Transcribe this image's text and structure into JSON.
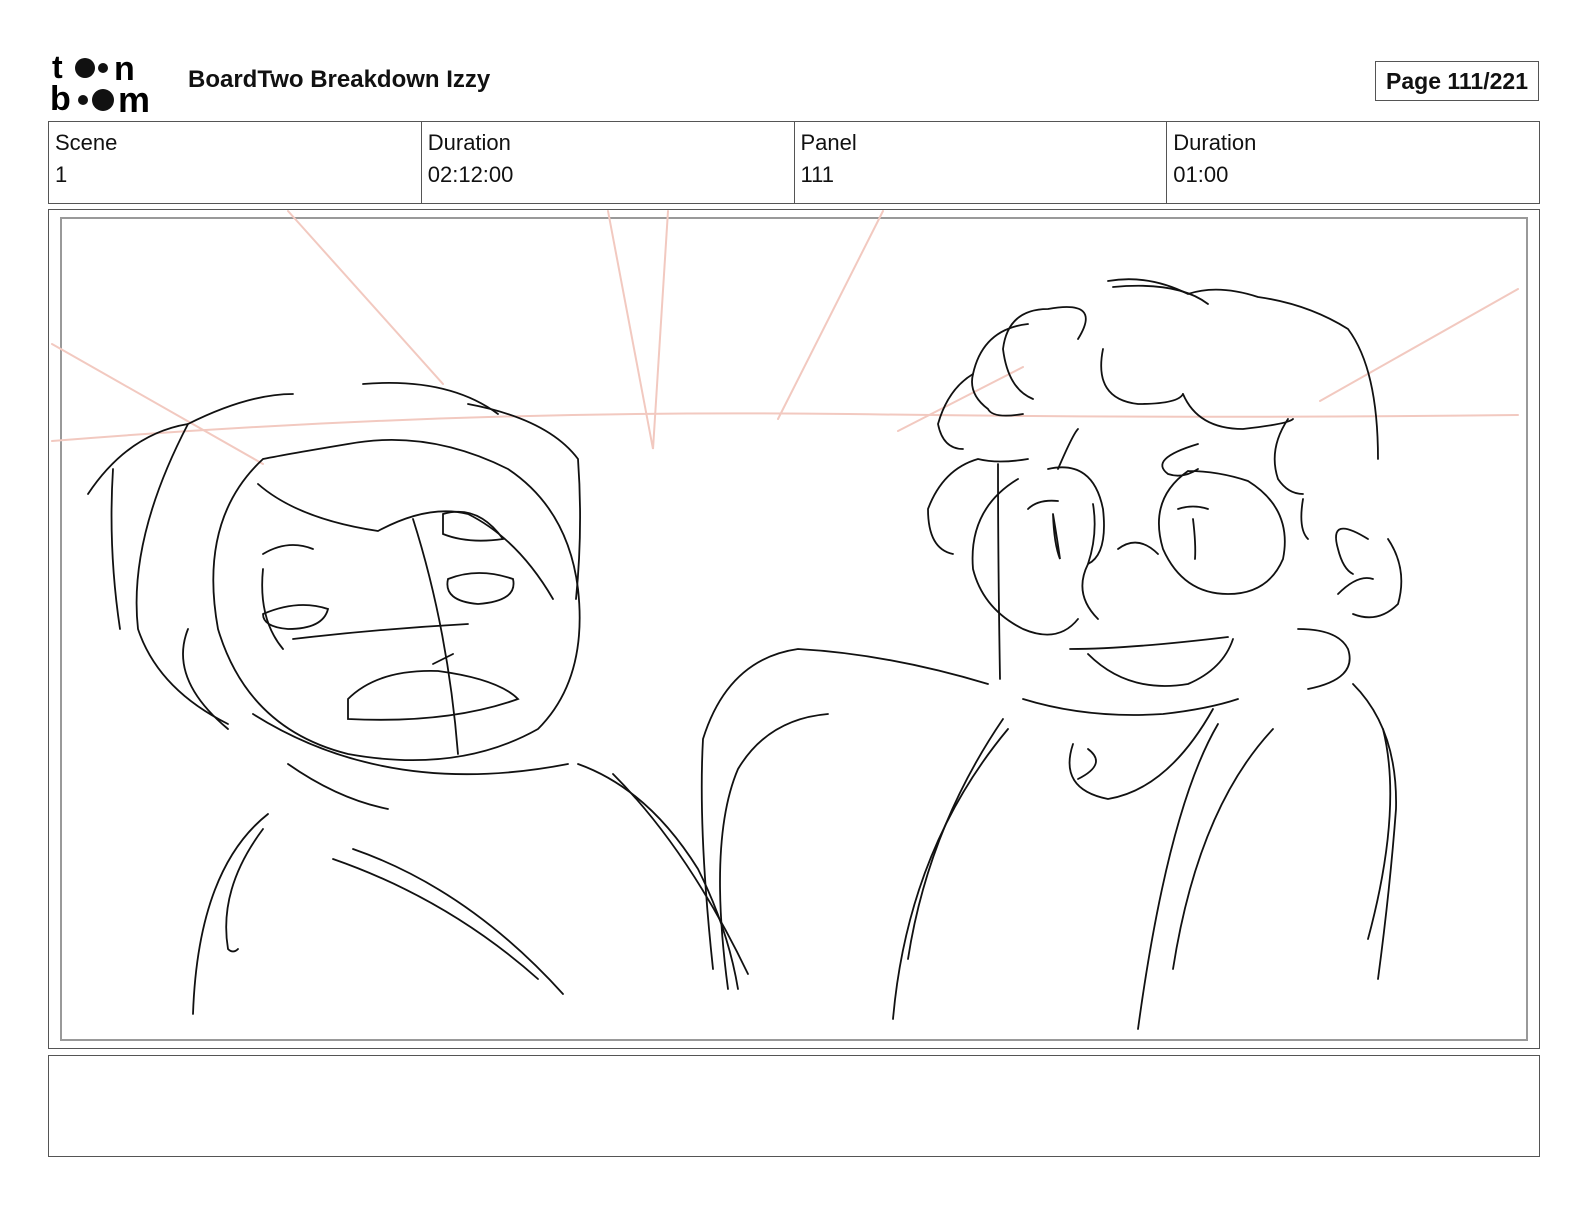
{
  "header": {
    "logo_alt": "toon boom",
    "title": "BoardTwo Breakdown Izzy",
    "page_label": "Page 111/221"
  },
  "info": {
    "scene_label": "Scene",
    "scene_value": "1",
    "scene_duration_label": "Duration",
    "scene_duration_value": "02:12:00",
    "panel_label": "Panel",
    "panel_value": "111",
    "panel_duration_label": "Duration",
    "panel_duration_value": "01:00"
  },
  "panel": {
    "image": "storyboard-sketch",
    "guide_color": "#f2c9c0",
    "line_color": "#111111"
  },
  "notes": {
    "text": ""
  }
}
